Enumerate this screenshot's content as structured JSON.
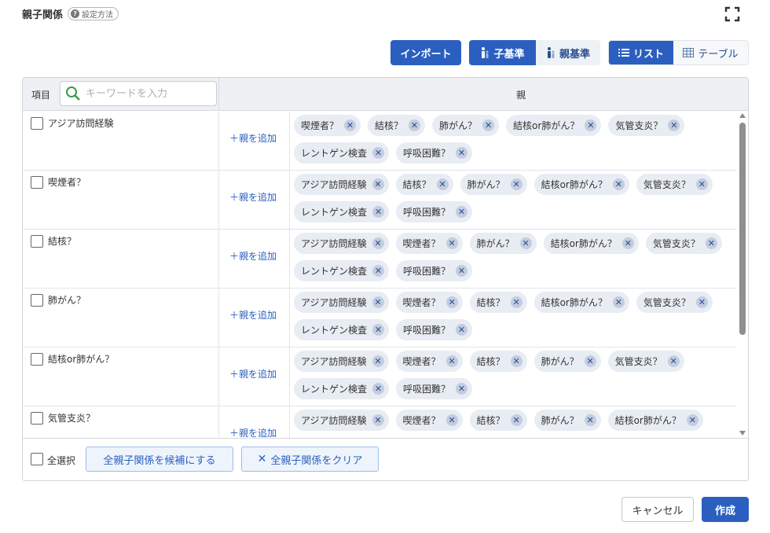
{
  "dialog": {
    "title": "親子関係",
    "help_label": "設定方法"
  },
  "toolbar": {
    "import_label": "インポート",
    "child_basis_label": "子基準",
    "parent_basis_label": "親基準",
    "list_label": "リスト",
    "table_label": "テーブル"
  },
  "table": {
    "item_header": "項目",
    "search_placeholder": "キーワードを入力",
    "parent_header": "親",
    "add_parent_label": "＋親を追加",
    "rows": [
      {
        "name": "アジア訪問経験",
        "parents": [
          "喫煙者？",
          "結核？",
          "肺がん？",
          "結核or肺がん？",
          "気管支炎？",
          "レントゲン検査",
          "呼吸困難？"
        ]
      },
      {
        "name": "喫煙者？",
        "parents": [
          "アジア訪問経験",
          "結核？",
          "肺がん？",
          "結核or肺がん？",
          "気管支炎？",
          "レントゲン検査",
          "呼吸困難？"
        ]
      },
      {
        "name": "結核？",
        "parents": [
          "アジア訪問経験",
          "喫煙者？",
          "肺がん？",
          "結核or肺がん？",
          "気管支炎？",
          "レントゲン検査",
          "呼吸困難？"
        ]
      },
      {
        "name": "肺がん？",
        "parents": [
          "アジア訪問経験",
          "喫煙者？",
          "結核？",
          "結核or肺がん？",
          "気管支炎？",
          "レントゲン検査",
          "呼吸困難？"
        ]
      },
      {
        "name": "結核or肺がん？",
        "parents": [
          "アジア訪問経験",
          "喫煙者？",
          "結核？",
          "肺がん？",
          "気管支炎？",
          "レントゲン検査",
          "呼吸困難？"
        ]
      },
      {
        "name": "気管支炎？",
        "parents": [
          "アジア訪問経験",
          "喫煙者？",
          "結核？",
          "肺がん？",
          "結核or肺がん？"
        ]
      }
    ]
  },
  "footer": {
    "select_all_label": "全選択",
    "candidate_all_label": "全親子関係を候補にする",
    "clear_all_label": "全親子関係をクリア"
  },
  "actions": {
    "cancel_label": "キャンセル",
    "create_label": "作成"
  },
  "colors": {
    "primary": "#2b5fbf",
    "chip_bg": "#e8ecf3"
  }
}
